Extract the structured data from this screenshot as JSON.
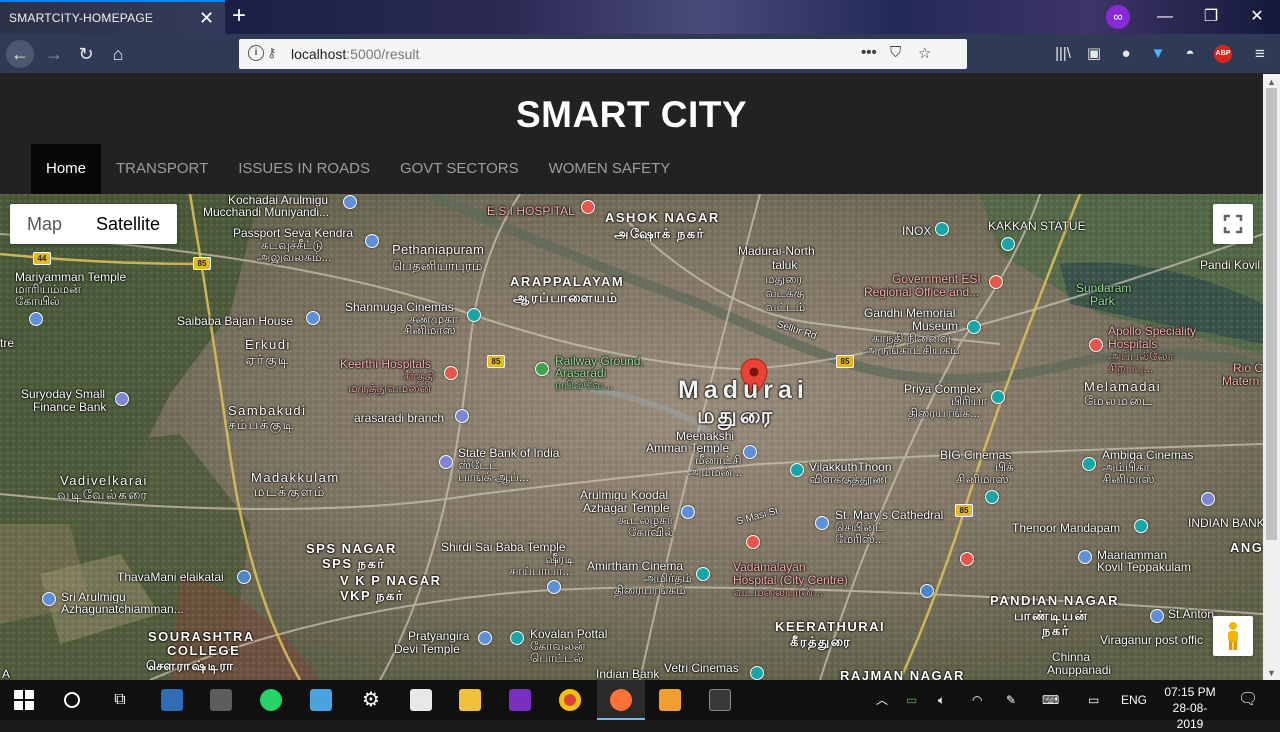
{
  "browser": {
    "tab_title": "SMARTCITY-HOMEPAGE",
    "url_host": "localhost",
    "url_rest": ":5000/result"
  },
  "site": {
    "title": "SMART CITY",
    "menu": [
      {
        "label": "Home",
        "active": true
      },
      {
        "label": "TRANSPORT"
      },
      {
        "label": "ISSUES IN ROADS"
      },
      {
        "label": "GOVT SECTORS"
      },
      {
        "label": "WOMEN SAFETY"
      }
    ]
  },
  "map": {
    "type_map": "Map",
    "type_satellite": "Satellite",
    "selected_type": "Satellite",
    "center_label": "Madurai",
    "center_label_tamil": "மதுரை",
    "labels": {
      "kochadai": "Kochadai Arulmigu",
      "kochadai2": "Mucchandi Muniyandi...",
      "esi": "E.S.I HOSPITAL",
      "ashok": "ASHOK NAGAR",
      "ashok_ta": "அஷோக் நகர்",
      "inox": "INOX",
      "kakkan": "KAKKAN STATUE",
      "pandi": "Pandi Kovil",
      "passport": "Passport Seva Kendra",
      "passport_ta": "கடவுச்சீட்டு",
      "passport_ta2": "அலுவலகம்...",
      "pethani": "Pethaniapuram",
      "pethani_ta": "பெதனியாபுரம்",
      "madurai_north": "Madurai-North",
      "taluk": "taluk",
      "taluk_ta": "மதுரை",
      "taluk_ta2": "வடக்கு",
      "taluk_ta3": "வட்டம்",
      "govt_esi": "Government ESI",
      "govt_esi2": "Regional Office and...",
      "sundaram": "Sundaram",
      "sundaram2": "Park",
      "mariyamman": "Mariyamman Temple",
      "mariyamman_ta": "மாரியம்மன்",
      "mariyamman_ta2": "கோயில்",
      "arappalayam": "ARAPPALAYAM",
      "arappalayam_ta": "ஆரப்பாளையம்",
      "shanmuga": "Shanmuga Cinemas",
      "shanmuga_ta": "சண்முகா",
      "shanmuga_ta2": "சினிமாஸ்",
      "gandhi": "Gandhi Memorial",
      "gandhi2": "Museum",
      "gandhi_ta": "காந்தி நினைவு",
      "gandhi_ta2": "அருங்காட்சியகம்",
      "apollo": "Apollo Speciality",
      "apollo2": "Hospitals",
      "apollo_ta": "அப்பல்லோ",
      "apollo_ta2": "சிறப்பு...",
      "saibaba": "Saibaba Bajan House",
      "sellur": "Sellur Rd",
      "erkudi": "Erkudi",
      "erkudi_ta": "ஏர்குடி",
      "tre": "tre",
      "keerthi": "Keerthi Hospitals",
      "keerthi_ta": "கீர்த்தி",
      "keerthi_ta2": "மருத்துவமனை",
      "railway": "Railway Ground,",
      "railway2": "Arasaradi",
      "railway_ta": "ரயில்வே...",
      "priya": "Priya Complex",
      "priya_ta": "பிரியா",
      "priya_ta2": "திரையரங்க...",
      "melamadai": "Melamadai",
      "melamadai_ta": "மேலமடை",
      "rio": "Rio C",
      "rio2": "Matern",
      "suryoday": "Suryoday Small",
      "suryoday2": "Finance Bank",
      "sambakudi": "Sambakudi",
      "sambakudi_ta": "சம்பக்குடி",
      "arasaradi_branch": "arasaradi branch",
      "meenakshi": "Meenakshi",
      "meenakshi2": "Amman Temple",
      "meenakshi_ta": "மீனாட்சி",
      "meenakshi_ta2": "அம்மன்...",
      "sbi": "State Bank of India",
      "sbi_ta": "ஸ்டேட்",
      "sbi_ta2": "பாங்க் ஆப்...",
      "vilakku": "VilakkuthThoon",
      "vilakku_ta": "விளக்குத்தூண்",
      "big": "BIG Cinemas",
      "big_ta": "பிக்",
      "big_ta2": "சினிமாஸ்",
      "ambiga": "Ambiga Cinemas",
      "ambiga_ta": "அம்பிகா",
      "ambiga_ta2": "சினிமாஸ்",
      "vadivel": "Vadivelkarai",
      "vadivel_ta": "வடிவேல்கரை",
      "madakkulam": "Madakkulam",
      "madakkulam_ta": "மடக்குளம்",
      "koodal": "Arulmigu Koodal",
      "koodal2": "Azhagar Temple",
      "koodal_ta": "கூடலழகர்",
      "koodal_ta2": "கோவில்",
      "masi": "S Masi St",
      "stmary": "St. Mary's Cathedral",
      "stmary_ta": "செயின்ட்",
      "stmary_ta2": "மேரிஸ்...",
      "thenoor": "Thenoor Mandapam",
      "indianbank": "INDIAN BANK",
      "ang": "ANG",
      "sps": "SPS NAGAR",
      "sps_ta": "SPS நகர்",
      "shirdi": "Shirdi Sai Baba Temple",
      "shirdi_ta": "ஷீரடி",
      "shirdi_ta2": "சாய்பாபா...",
      "amirtham": "Amirtham Cinema",
      "amirtham_ta": "அமிர்தம்",
      "amirtham_ta2": "திரையரங்கம்",
      "vadamalayan": "Vadamalayan",
      "vadamalayan2": "Hospital (City Centre)",
      "vadamalayan_ta": "வடமலையான்...",
      "maariamman": "Maariamman",
      "maariamman2": "Kovil Teppakulam",
      "vkp": "V K P NAGAR",
      "vkp_ta": "VKP நகர்",
      "thavamani": "ThavaMani elaikatai",
      "sriarulmigu": "Sri Arulmigu",
      "sriarulmigu2": "Azhagunatchiamman...",
      "pandian": "PANDIAN NAGAR",
      "pandian_ta": "பாண்டியன்",
      "pandian_ta2": "நகர்",
      "stanton": "St.Anton",
      "sourashtra": "SOURASHTRA",
      "sourashtra2": "COLLEGE",
      "sourashtra_ta": "சௌராஷ்டிரா",
      "pratyangira": "Pratyangira",
      "pratyangira2": "Devi Temple",
      "kovalan": "Kovalan Pottal",
      "kovalan_ta": "கோவலன்",
      "kovalan_ta2": "பொட்டல்",
      "keerathurai": "KEERATHURAI",
      "keerathurai_ta": "கீரத்துரை",
      "viraganur": "Viraganur post offic",
      "chinna": "Chinna",
      "chinna2": "Anuppanadi",
      "indianbank2": "Indian Bank",
      "vetri": "Vetri Cinemas",
      "rajman": "RAJMAN NAGAR",
      "a": "A"
    },
    "highways": [
      "44",
      "85",
      "85",
      "85",
      "85"
    ]
  },
  "taskbar": {
    "lang": "ENG",
    "time": "07:15 PM",
    "date": "28-08-2019"
  }
}
